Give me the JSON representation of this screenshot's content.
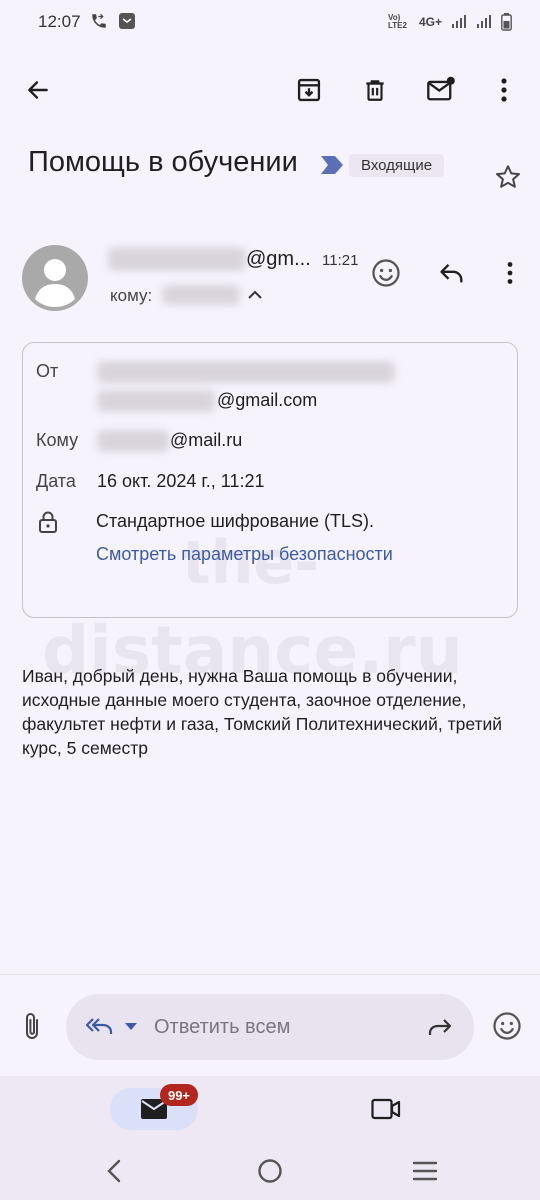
{
  "status_bar": {
    "time": "12:07",
    "volte_line1": "Vo) LTE2",
    "network": "4G+"
  },
  "toolbar": {
    "icons": [
      "back-arrow-icon",
      "archive-icon",
      "delete-icon",
      "mark-unread-icon",
      "more-vert-icon"
    ]
  },
  "email": {
    "subject": "Помощь в обучении",
    "label": "Входящие",
    "sender_visible_tail": "@gm...",
    "time": "11:21",
    "to_prefix": "кому:",
    "details": {
      "from_label": "От",
      "from_email_tail": "@gmail.com",
      "to_label": "Кому",
      "to_email_tail": "@mail.ru",
      "date_label": "Дата",
      "date_value": "16 окт. 2024 г., 11:21",
      "encryption": "Стандартное шифрование (TLS).",
      "security_link": "Смотреть параметры безопасности"
    },
    "body": "Иван, добрый день, нужна Ваша помощь в обучении, исходные данные моего студента, заочное отделение, факультет нефти и газа, Томский Политехнический, третий курс, 5 семестр"
  },
  "watermark": {
    "line1": "the-",
    "line2": "distance.ru"
  },
  "reply_bar": {
    "placeholder": "Ответить всем"
  },
  "bottom_nav": {
    "mail_badge": "99+"
  },
  "colors": {
    "background": "#f7f3fc",
    "link": "#3b5ba9",
    "label_arrow": "#5b6fb5",
    "badge": "#b3261e"
  }
}
